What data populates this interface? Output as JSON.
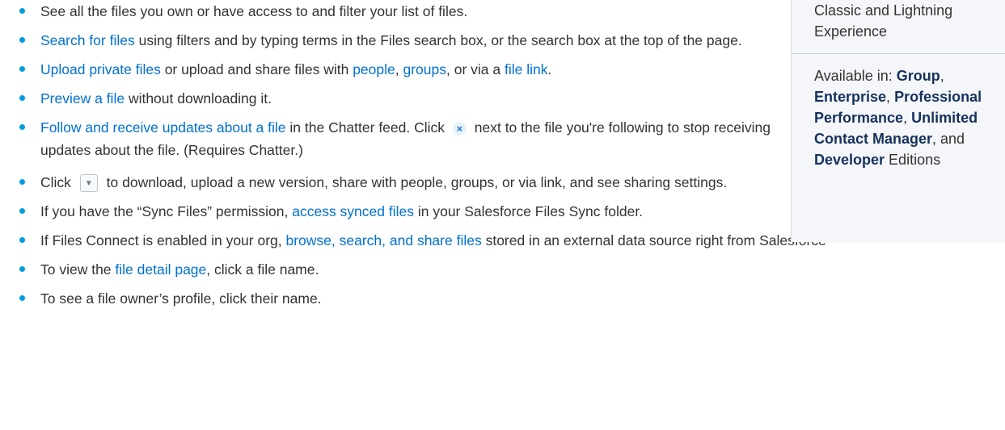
{
  "bullets": {
    "b1": {
      "text": "See all the files you own or have access to and filter your list of files."
    },
    "b2": {
      "link": "Search for files",
      "text": " using filters and by typing terms in the Files search box, or the search box at the top of the page."
    },
    "b3": {
      "link1": "Upload private files",
      "t1": " or upload and share files with ",
      "link2": "people",
      "t2": ", ",
      "link3": "groups",
      "t3": ", or via a ",
      "link4": "file link",
      "t4": "."
    },
    "b4": {
      "link": "Preview a file",
      "text": " without downloading it."
    },
    "b5": {
      "link": "Follow and receive updates about a file",
      "t1": " in the Chatter feed. Click ",
      "icon": "close-icon",
      "t2": " next to the file you're following to stop receiving updates about the file. (Requires Chatter.)"
    },
    "b6": {
      "t1": "Click ",
      "icon": "chevron-down-icon",
      "t2": " to download, upload a new version, share with people, groups, or via link, and see sharing settings."
    },
    "b7": {
      "t1": "If you have the “Sync Files” permission, ",
      "link": "access synced files",
      "t2": " in your Salesforce Files Sync folder."
    },
    "b8": {
      "t1": "If Files Connect is enabled in your org, ",
      "link": "browse, search, and share files",
      "t2": " stored in an external data source right from Salesforce"
    },
    "b9": {
      "t1": "To view the ",
      "link": "file detail page",
      "t2": ", click a file name."
    },
    "b10": {
      "text": "To see a file owner’s profile, click their name."
    }
  },
  "sidebar": {
    "line1": "Classic and Lightning",
    "line2": "Experience",
    "available_label": "Available in: ",
    "e_group": "Group",
    "e_enterprise": "Enterprise",
    "e_professional": "Professional",
    "e_performance": "Performance",
    "e_unlimited": "Unlimited",
    "e_contact": "Contact Manager",
    "e_developer": "Developer",
    "sep_comma": ",",
    "sep_comma_space": ", ",
    "and_text": ", and",
    "editions_text": " Editions"
  },
  "colors": {
    "link": "#0070d2",
    "bullet": "#009ddc",
    "sidebar_bg": "#f4f6f9"
  }
}
